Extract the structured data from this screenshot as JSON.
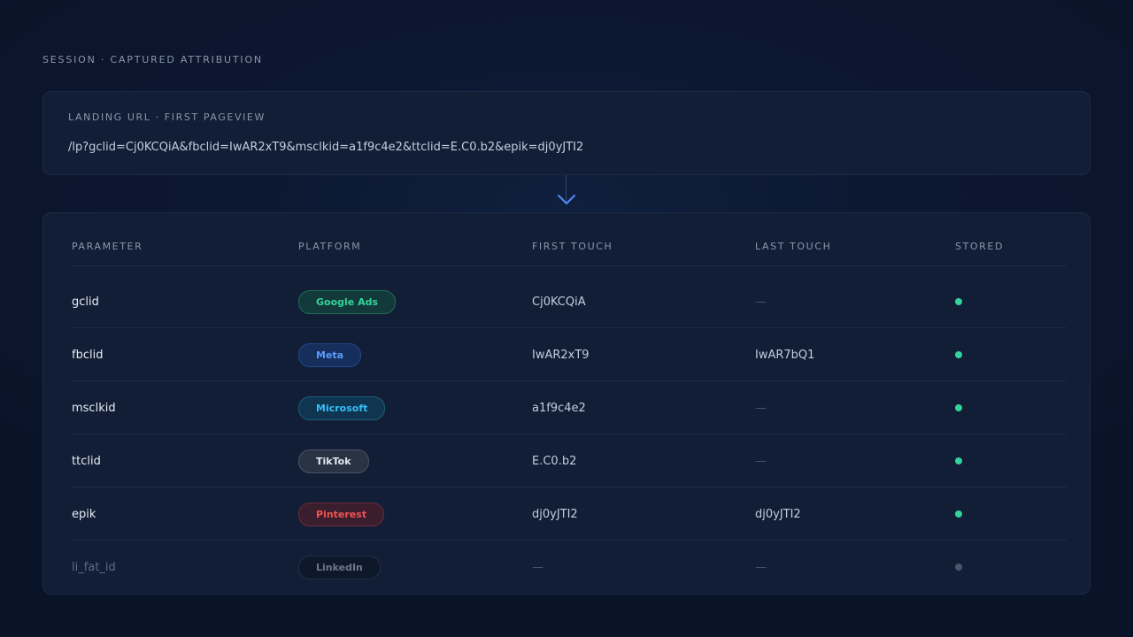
{
  "header": {
    "eyebrow": "SESSION · CAPTURED ATTRIBUTION"
  },
  "landing": {
    "label": "LANDING URL · FIRST PAGEVIEW",
    "url": "/lp?gclid=Cj0KCQiA&fbclid=IwAR2xT9&msclkid=a1f9c4e2&ttclid=E.C0.b2&epik=dj0yJTI2"
  },
  "table": {
    "columns": [
      "PARAMETER",
      "PLATFORM",
      "FIRST TOUCH",
      "LAST TOUCH",
      "STORED"
    ],
    "rows": [
      {
        "param": "gclid",
        "platform": "Google Ads",
        "first": "Cj0KCQiA",
        "last": "—",
        "stored": true,
        "pill": {
          "text": "#34d399",
          "bg": "#123a3a",
          "border": "#1f6b5a"
        }
      },
      {
        "param": "fbclid",
        "platform": "Meta",
        "first": "IwAR2xT9",
        "last": "IwAR7bQ1",
        "stored": true,
        "pill": {
          "text": "#5b9bff",
          "bg": "#152e5c",
          "border": "#24468a"
        }
      },
      {
        "param": "msclkid",
        "platform": "Microsoft",
        "first": "a1f9c4e2",
        "last": "—",
        "stored": true,
        "pill": {
          "text": "#38bdf8",
          "bg": "#0f3550",
          "border": "#1d5e7a"
        }
      },
      {
        "param": "ttclid",
        "platform": "TikTok",
        "first": "E.C0.b2",
        "last": "—",
        "stored": true,
        "pill": {
          "text": "#e2e8f0",
          "bg": "#2a3344",
          "border": "#475266"
        }
      },
      {
        "param": "epik",
        "platform": "Pinterest",
        "first": "dj0yJTI2",
        "last": "dj0yJTI2",
        "stored": true,
        "pill": {
          "text": "#f05252",
          "bg": "#3b1e2e",
          "border": "#6b2b3c"
        }
      },
      {
        "param": "li_fat_id",
        "platform": "LinkedIn",
        "first": "—",
        "last": "—",
        "stored": false,
        "pill": {
          "text": "#6b778c",
          "bg": "#0e182b",
          "border": "#222f47"
        }
      }
    ]
  },
  "colors": {
    "stored_on": "#34d399",
    "stored_off": "#4a5568",
    "arrow": "#4f8ef7"
  }
}
